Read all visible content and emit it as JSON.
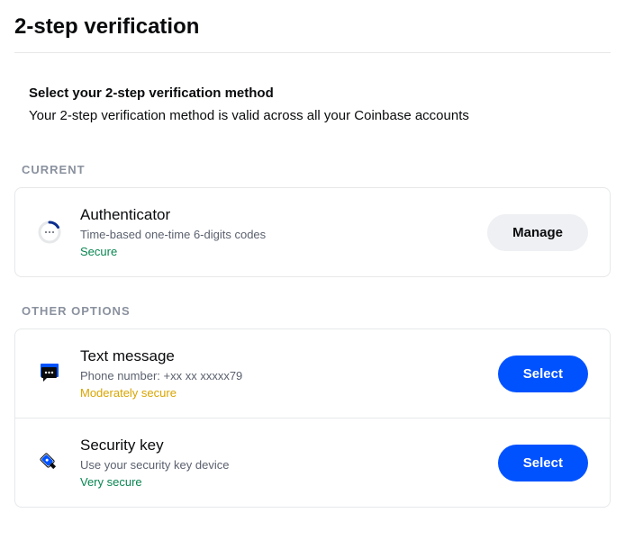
{
  "pageTitle": "2-step verification",
  "intro": {
    "heading": "Select your 2-step verification method",
    "sub": "Your 2-step verification method is valid across all your Coinbase accounts"
  },
  "sections": {
    "current": {
      "label": "CURRENT",
      "item": {
        "title": "Authenticator",
        "desc": "Time-based one-time 6-digits codes",
        "badge": "Secure",
        "action": "Manage"
      }
    },
    "other": {
      "label": "OTHER OPTIONS",
      "items": [
        {
          "title": "Text message",
          "desc": "Phone number: +xx xx xxxxx79",
          "badge": "Moderately secure",
          "action": "Select"
        },
        {
          "title": "Security key",
          "desc": "Use your security key device",
          "badge": "Very secure",
          "action": "Select"
        }
      ]
    }
  }
}
